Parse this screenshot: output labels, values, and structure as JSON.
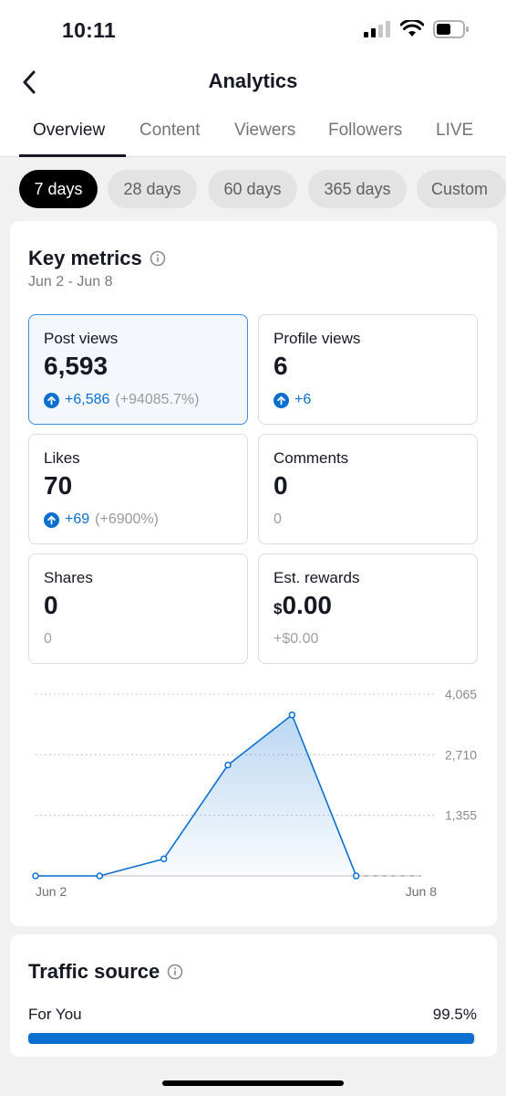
{
  "status_bar": {
    "time": "10:11"
  },
  "header": {
    "title": "Analytics"
  },
  "tabs": [
    {
      "label": "Overview"
    },
    {
      "label": "Content"
    },
    {
      "label": "Viewers"
    },
    {
      "label": "Followers"
    },
    {
      "label": "LIVE"
    }
  ],
  "range_chips": [
    {
      "label": "7 days"
    },
    {
      "label": "28 days"
    },
    {
      "label": "60 days"
    },
    {
      "label": "365 days"
    },
    {
      "label": "Custom"
    }
  ],
  "key_metrics": {
    "title": "Key metrics",
    "date_range": "Jun 2 - Jun 8",
    "cards": [
      {
        "label": "Post views",
        "value": "6,593",
        "delta": "+6,586",
        "delta_pct": "(+94085.7%)"
      },
      {
        "label": "Profile views",
        "value": "6",
        "delta": "+6",
        "delta_pct": ""
      },
      {
        "label": "Likes",
        "value": "70",
        "delta": "+69",
        "delta_pct": "(+6900%)"
      },
      {
        "label": "Comments",
        "value": "0",
        "delta": "0",
        "delta_pct": ""
      },
      {
        "label": "Shares",
        "value": "0",
        "delta": "0",
        "delta_pct": ""
      },
      {
        "label": "Est. rewards",
        "currency": "$",
        "value": "0.00",
        "delta": "+$0.00",
        "delta_pct": ""
      }
    ]
  },
  "chart_data": {
    "type": "area",
    "x": [
      "Jun 2",
      "Jun 3",
      "Jun 4",
      "Jun 5",
      "Jun 6",
      "Jun 7",
      "Jun 8"
    ],
    "series": [
      {
        "values": [
          0,
          0,
          380,
          2480,
          3600,
          0,
          0
        ],
        "future": [
          false,
          false,
          false,
          false,
          false,
          false,
          true
        ]
      }
    ],
    "x_tick_labels": [
      "Jun 2",
      "Jun 8"
    ],
    "y_ticks": [
      "1,355",
      "2,710",
      "4,065"
    ],
    "ylim": [
      0,
      4065
    ],
    "grid": "dotted horizontal",
    "color": "#0b6fcf"
  },
  "traffic_source": {
    "title": "Traffic source",
    "rows": [
      {
        "label": "For You",
        "value": "99.5%",
        "fraction": 0.995
      }
    ]
  },
  "colors": {
    "accent": "#0b6fcf",
    "chip_active": "#000000"
  }
}
